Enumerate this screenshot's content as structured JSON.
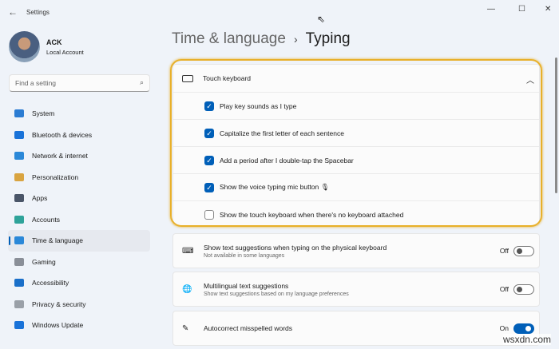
{
  "window": {
    "title": "Settings",
    "minimize": "—",
    "maximize": "☐",
    "close": "✕"
  },
  "user": {
    "name": "ACK",
    "type": "Local Account"
  },
  "search": {
    "placeholder": "Find a setting"
  },
  "sidebar": {
    "items": [
      {
        "label": "System",
        "color": "#2b7cd3"
      },
      {
        "label": "Bluetooth & devices",
        "color": "#1a73d9"
      },
      {
        "label": "Network & internet",
        "color": "#2b88d8"
      },
      {
        "label": "Personalization",
        "color": "#d9a441"
      },
      {
        "label": "Apps",
        "color": "#4a5568"
      },
      {
        "label": "Accounts",
        "color": "#2fa39a"
      },
      {
        "label": "Time & language",
        "color": "#2b88d8",
        "active": true
      },
      {
        "label": "Gaming",
        "color": "#8a8f98"
      },
      {
        "label": "Accessibility",
        "color": "#1a6fc9"
      },
      {
        "label": "Privacy & security",
        "color": "#9aa0a8"
      },
      {
        "label": "Windows Update",
        "color": "#1a73d9"
      }
    ]
  },
  "header": {
    "parent": "Time & language",
    "separator": "›",
    "title": "Typing"
  },
  "touch_keyboard": {
    "title": "Touch keyboard",
    "options": [
      {
        "label": "Play key sounds as I type",
        "checked": true
      },
      {
        "label": "Capitalize the first letter of each sentence",
        "checked": true
      },
      {
        "label": "Add a period after I double-tap the Spacebar",
        "checked": true
      },
      {
        "label": "Show the voice typing mic button 🎙",
        "checked": true
      },
      {
        "label": "Show the touch keyboard when there's no keyboard attached",
        "checked": false
      }
    ]
  },
  "settings": [
    {
      "title": "Show text suggestions when typing on the physical keyboard",
      "subtitle": "Not available in some languages",
      "state": "Off",
      "on": false,
      "icon": "⌨"
    },
    {
      "title": "Multilingual text suggestions",
      "subtitle": "Show text suggestions based on my language preferences",
      "state": "Off",
      "on": false,
      "icon": "🌐"
    },
    {
      "title": "Autocorrect misspelled words",
      "state": "On",
      "on": true,
      "icon": "✎"
    }
  ],
  "watermark": "wsxdn.com"
}
